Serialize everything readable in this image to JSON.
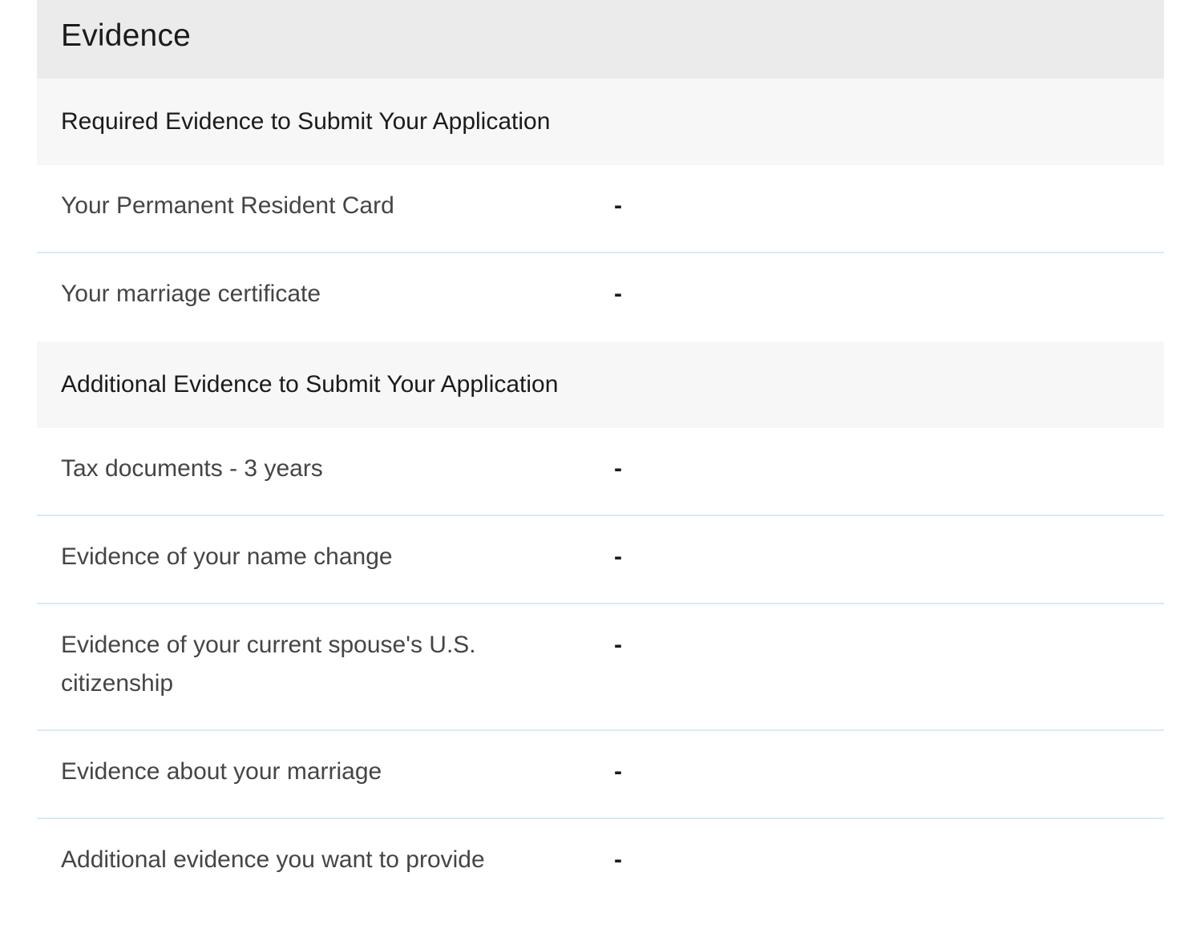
{
  "panel": {
    "title": "Evidence"
  },
  "sections": [
    {
      "title": "Required Evidence to Submit Your Application",
      "rows": [
        {
          "label": "Your Permanent Resident Card",
          "value": "-"
        },
        {
          "label": "Your marriage certificate",
          "value": "-"
        }
      ]
    },
    {
      "title": "Additional Evidence to Submit Your Application",
      "rows": [
        {
          "label": "Tax documents - 3 years",
          "value": "-"
        },
        {
          "label": "Evidence of your name change",
          "value": "-"
        },
        {
          "label": "Evidence of your current spouse's U.S. citizenship",
          "value": "-"
        },
        {
          "label": "Evidence about your marriage",
          "value": "-"
        },
        {
          "label": "Additional evidence you want to provide",
          "value": "-"
        }
      ]
    }
  ],
  "colors": {
    "header_bg": "#ebebeb",
    "section_bg": "#f7f7f7",
    "divider": "#d6ebf5",
    "label_text": "#454545",
    "title_text": "#1b1b1b"
  }
}
